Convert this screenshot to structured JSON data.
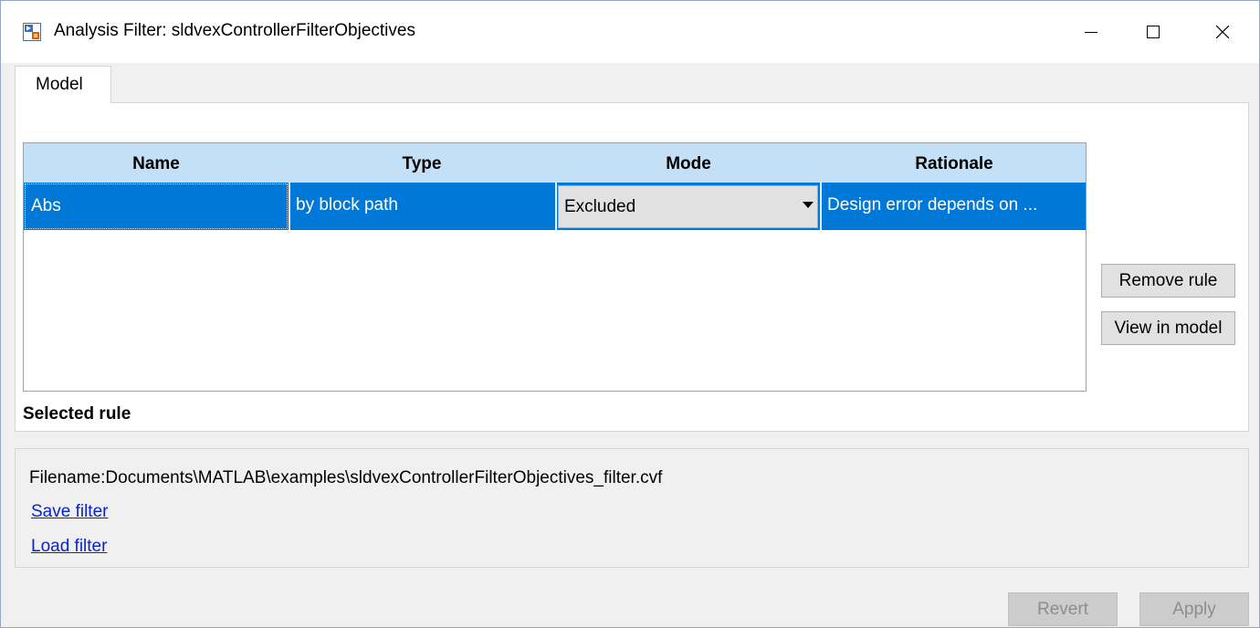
{
  "window": {
    "title": "Analysis Filter: sldvexControllerFilterObjectives",
    "icon": "simulink-model-icon"
  },
  "tabs": [
    {
      "label": "Model",
      "selected": true
    }
  ],
  "table": {
    "columns": [
      "Name",
      "Type",
      "Mode",
      "Rationale"
    ],
    "rows": [
      {
        "name": "Abs",
        "type": "by block path",
        "mode": "Excluded",
        "rationale": "Design error depends on ...",
        "selected": true
      }
    ]
  },
  "side_buttons": {
    "remove_label": "Remove rule",
    "view_label": "View in model"
  },
  "selected_rule_label": "Selected rule",
  "file": {
    "label": "Filename:",
    "path": "Documents\\MATLAB\\examples\\sldvexControllerFilterObjectives_filter.cvf",
    "save_link": "Save filter",
    "load_link": "Load filter"
  },
  "footer": {
    "revert_label": "Revert",
    "apply_label": "Apply",
    "revert_enabled": false,
    "apply_enabled": false
  },
  "colors": {
    "selection": "#0078d7",
    "header": "#c3e0f7",
    "link": "#0a24cc"
  }
}
